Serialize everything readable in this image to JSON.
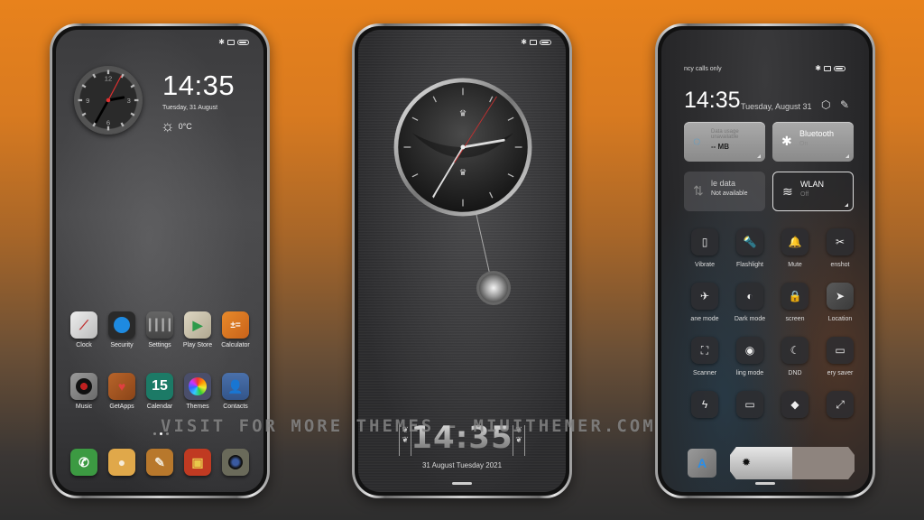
{
  "colors": {
    "background_top": "#e8821c",
    "background_bottom": "#2e2e2e",
    "accent_blue": "#2a8ee8",
    "clock_second_hand": "#e03030"
  },
  "watermark": "VISIT FOR MORE THEMES - MIUITHEMER.COM",
  "home_screen": {
    "status_icons": [
      "bluetooth-icon",
      "sim-icon",
      "battery-icon"
    ],
    "clock_numerals": [
      "12",
      "3",
      "6",
      "9"
    ],
    "time": "14:35",
    "date": "Tuesday, 31 August",
    "weather_icon": "sun-icon",
    "temperature": "0°C",
    "page_indicator": {
      "count": 3,
      "active_index": 1
    },
    "apps_row1": [
      {
        "label": "Clock",
        "icon": "clock-icon",
        "color": "#d8d8d8"
      },
      {
        "label": "Security",
        "icon": "security-icon",
        "color": "#2a2a2a"
      },
      {
        "label": "Settings",
        "icon": "settings-icon",
        "color": "#555555"
      },
      {
        "label": "Play Store",
        "icon": "play-store-icon",
        "color": "#c8c2b0"
      },
      {
        "label": "Calculator",
        "icon": "calculator-icon",
        "color": "#d9731e"
      }
    ],
    "apps_row2": [
      {
        "label": "Music",
        "icon": "music-icon",
        "color": "#8a8a8a"
      },
      {
        "label": "GetApps",
        "icon": "getapps-icon",
        "color": "#a9561e"
      },
      {
        "label": "Calendar",
        "icon": "calendar-icon",
        "color": "#1c7a66",
        "text": "15"
      },
      {
        "label": "Themes",
        "icon": "themes-icon",
        "color": "#4a4e6a"
      },
      {
        "label": "Contacts",
        "icon": "contacts-icon",
        "color": "#3a5f9a"
      }
    ],
    "dock": [
      {
        "icon": "phone-icon",
        "color": "#3c9a42"
      },
      {
        "icon": "messages-icon",
        "color": "#e0a84a"
      },
      {
        "icon": "notes-icon",
        "color": "#b8782c"
      },
      {
        "icon": "gallery-icon",
        "color": "#c03a22"
      },
      {
        "icon": "camera-icon",
        "color": "#6a6a5a"
      }
    ]
  },
  "lock_screen": {
    "status_icons": [
      "bluetooth-icon",
      "sim-icon",
      "battery-icon"
    ],
    "time": "14:35",
    "date": "31 August Tuesday 2021"
  },
  "control_center": {
    "carrier": "ncy calls only",
    "status_icons": [
      "bluetooth-icon",
      "sim-icon",
      "battery-icon"
    ],
    "time": "14:35",
    "date": "Tuesday, August 31",
    "tiles": [
      {
        "title": "Data usage unavailable",
        "sub": "-- MB",
        "icon": "data-usage-icon",
        "state": "on"
      },
      {
        "title": "Bluetooth",
        "sub": "On",
        "icon": "bluetooth-icon",
        "state": "on"
      },
      {
        "title": "le data",
        "sub": "Not available",
        "icon": "mobile-data-icon",
        "state": "unavailable"
      },
      {
        "title": "WLAN",
        "sub": "Off",
        "icon": "wifi-icon",
        "state": "off"
      }
    ],
    "toggles": [
      {
        "label": "Vibrate",
        "icon": "vibrate-icon",
        "glyph": "▯",
        "on": false
      },
      {
        "label": "Flashlight",
        "icon": "flashlight-icon",
        "glyph": "🔦",
        "on": false
      },
      {
        "label": "Mute",
        "icon": "bell-icon",
        "glyph": "🔔",
        "on": false
      },
      {
        "label": "enshot",
        "icon": "screenshot-icon",
        "glyph": "✂",
        "on": false
      },
      {
        "label": "ane mode",
        "icon": "airplane-icon",
        "glyph": "✈",
        "on": false
      },
      {
        "label": "Dark mode",
        "icon": "dark-mode-icon",
        "glyph": "◐",
        "on": false
      },
      {
        "label": "screen",
        "icon": "lock-icon",
        "glyph": "🔒",
        "on": false
      },
      {
        "label": "Location",
        "icon": "location-icon",
        "glyph": "➤",
        "on": true
      },
      {
        "label": "Scanner",
        "icon": "scanner-icon",
        "glyph": "⛶",
        "on": false
      },
      {
        "label": "ling mode",
        "icon": "reading-mode-icon",
        "glyph": "◉",
        "on": false
      },
      {
        "label": "DND",
        "icon": "moon-icon",
        "glyph": "☾",
        "on": false
      },
      {
        "label": "ery saver",
        "icon": "battery-saver-icon",
        "glyph": "▭",
        "on": false
      },
      {
        "label": "",
        "icon": "lightning-icon",
        "glyph": "ϟ",
        "on": false
      },
      {
        "label": "",
        "icon": "cast-icon",
        "glyph": "▭",
        "on": false
      },
      {
        "label": "",
        "icon": "mi-share-icon",
        "glyph": "◆",
        "on": false
      },
      {
        "label": "",
        "icon": "fullscreen-icon",
        "glyph": "⤢",
        "on": false
      }
    ],
    "auto_brightness_label": "A",
    "brightness_level": 0.5
  }
}
